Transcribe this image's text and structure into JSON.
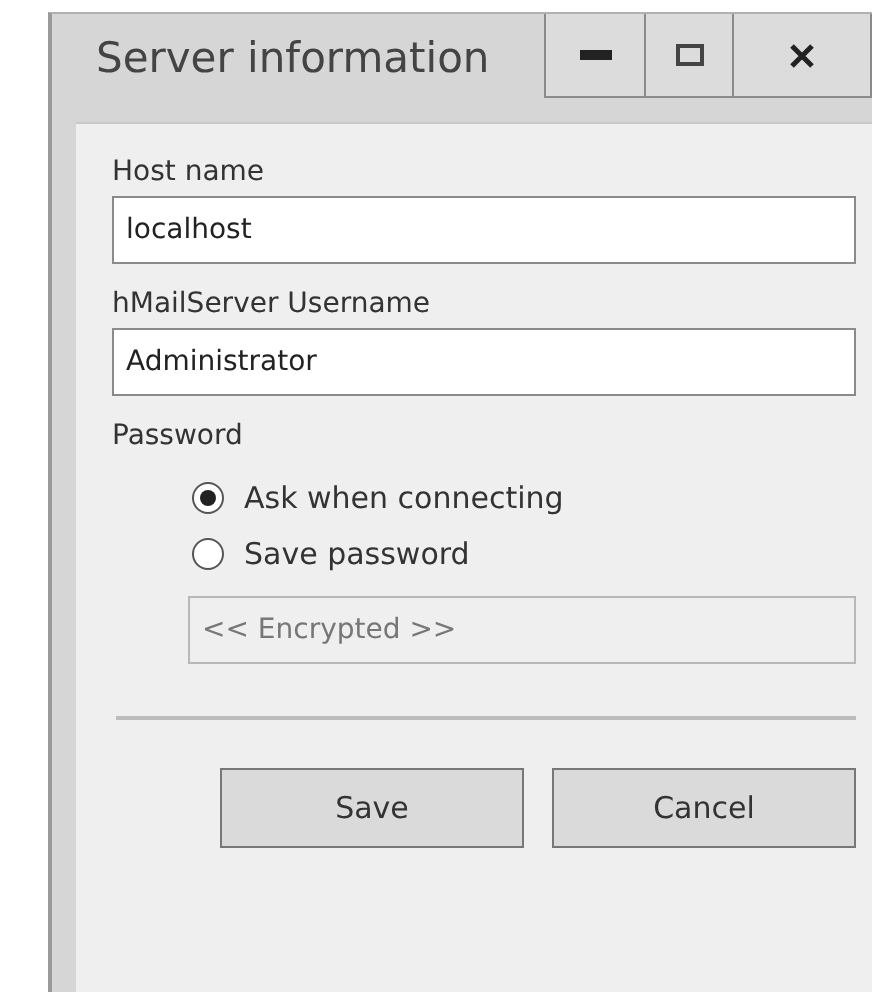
{
  "window": {
    "title": "Server information"
  },
  "host": {
    "label": "Host name",
    "value": "localhost"
  },
  "username": {
    "label": "hMailServer Username",
    "value": "Administrator"
  },
  "password": {
    "label": "Password",
    "options": [
      {
        "label": "Ask when connecting",
        "selected": true
      },
      {
        "label": "Save password",
        "selected": false
      }
    ],
    "field": {
      "value": "<< Encrypted >>",
      "disabled": true
    }
  },
  "buttons": [
    "Save",
    "Cancel"
  ]
}
